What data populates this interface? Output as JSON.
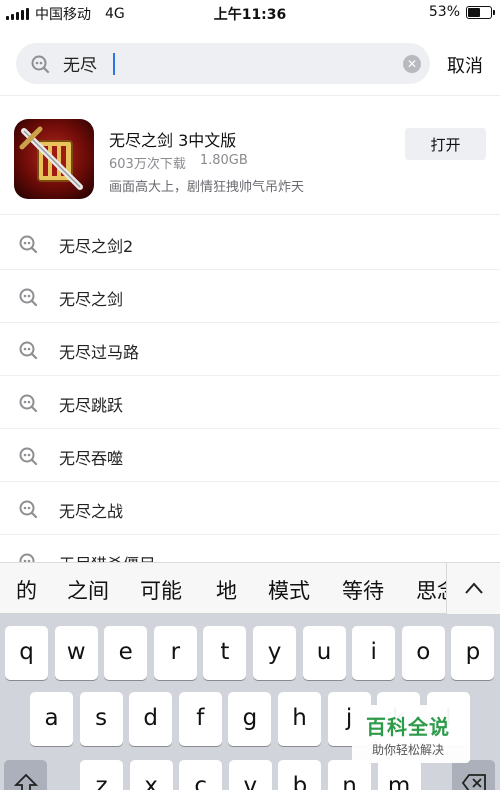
{
  "status_bar": {
    "carrier": "中国移动",
    "network": "4G",
    "time": "上午11:36",
    "battery_text": "53%",
    "battery_level": 0.53
  },
  "search": {
    "query": "无尽",
    "placeholder": "",
    "cancel_label": "取消"
  },
  "app_result": {
    "title": "无尽之剑 3中文版",
    "downloads": "603万次下载",
    "size": "1.80GB",
    "description": "画面高大上，剧情狂拽帅气吊炸天",
    "open_label": "打开",
    "icon": "sword-shield-app-icon"
  },
  "suggestions": [
    "无尽之剑2",
    "无尽之剑",
    "无尽过马路",
    "无尽跳跃",
    "无尽吞噬",
    "无尽之战",
    "无尽猎杀僵尸"
  ],
  "keyboard": {
    "candidates": [
      "的",
      "之间",
      "可能",
      "地",
      "模式",
      "等待",
      "思念"
    ],
    "row1": [
      "q",
      "w",
      "e",
      "r",
      "t",
      "y",
      "u",
      "i",
      "o",
      "p"
    ],
    "row2": [
      "a",
      "s",
      "d",
      "f",
      "g",
      "h",
      "j",
      "k",
      "l"
    ],
    "row3": [
      "z",
      "x",
      "c",
      "v",
      "b",
      "n",
      "m"
    ]
  },
  "watermark": {
    "title": "百科全说",
    "subtitle": "助你轻松解决"
  },
  "colors": {
    "search_bg": "#eeeff2",
    "caret": "#2a73e8",
    "keyboard_bg": "#d1d4da",
    "watermark_green": "#2e9b4a"
  }
}
